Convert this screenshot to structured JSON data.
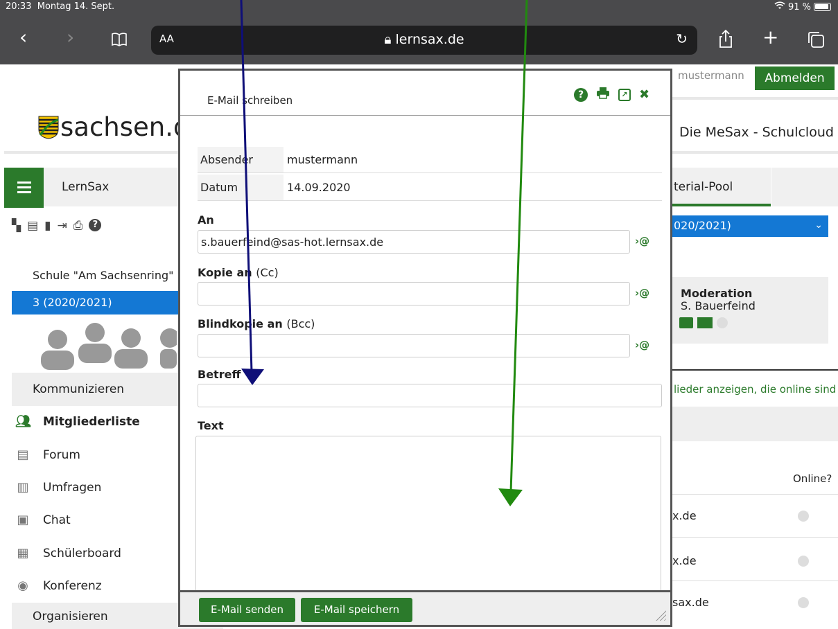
{
  "status": {
    "time": "20:33",
    "date": "Montag 14. Sept.",
    "battery": "91 %"
  },
  "browser": {
    "aa": "AA",
    "url": "lernsax.de"
  },
  "page": {
    "user": "mustermann",
    "logout": "Abmelden",
    "logo": "sachsen.de",
    "site_title": "Die MeSax - Schulcloud",
    "lernsax_tab": "LernSax",
    "material_tab": "terial-Pool",
    "school": "Schule \"Am Sachsenring\"",
    "class": "3 (2020/2021)",
    "year_select": "020/2021)",
    "section_komm": "Kommunizieren",
    "section_org": "Organisieren",
    "nav": [
      "Mitgliederliste",
      "Forum",
      "Umfragen",
      "Chat",
      "Schülerboard",
      "Konferenz"
    ],
    "moderation_title": "Moderation",
    "moderation_name": "S. Bauerfeind",
    "online_link": "lieder anzeigen, die online sind",
    "online_head": "Online?",
    "rows": [
      "x.de",
      "x.de",
      "sax.de"
    ]
  },
  "modal": {
    "title": "E-Mail schreiben",
    "sender_label": "Absender",
    "sender_value": "mustermann",
    "date_label": "Datum",
    "date_value": "14.09.2020",
    "to_label": "An",
    "to_value": "s.bauerfeind@sas-hot.lernsax.de",
    "cc_label": "Kopie an",
    "cc_suffix": "(Cc)",
    "bcc_label": "Blindkopie an",
    "bcc_suffix": "(Bcc)",
    "subject_label": "Betreff",
    "text_label": "Text",
    "addr_btn": "›@",
    "send": "E-Mail senden",
    "save": "E-Mail speichern"
  },
  "colors": {
    "green": "#2b7a2b",
    "blue": "#1478d4",
    "arrow_blue": "#0f0f78",
    "arrow_green": "#218a0f"
  }
}
